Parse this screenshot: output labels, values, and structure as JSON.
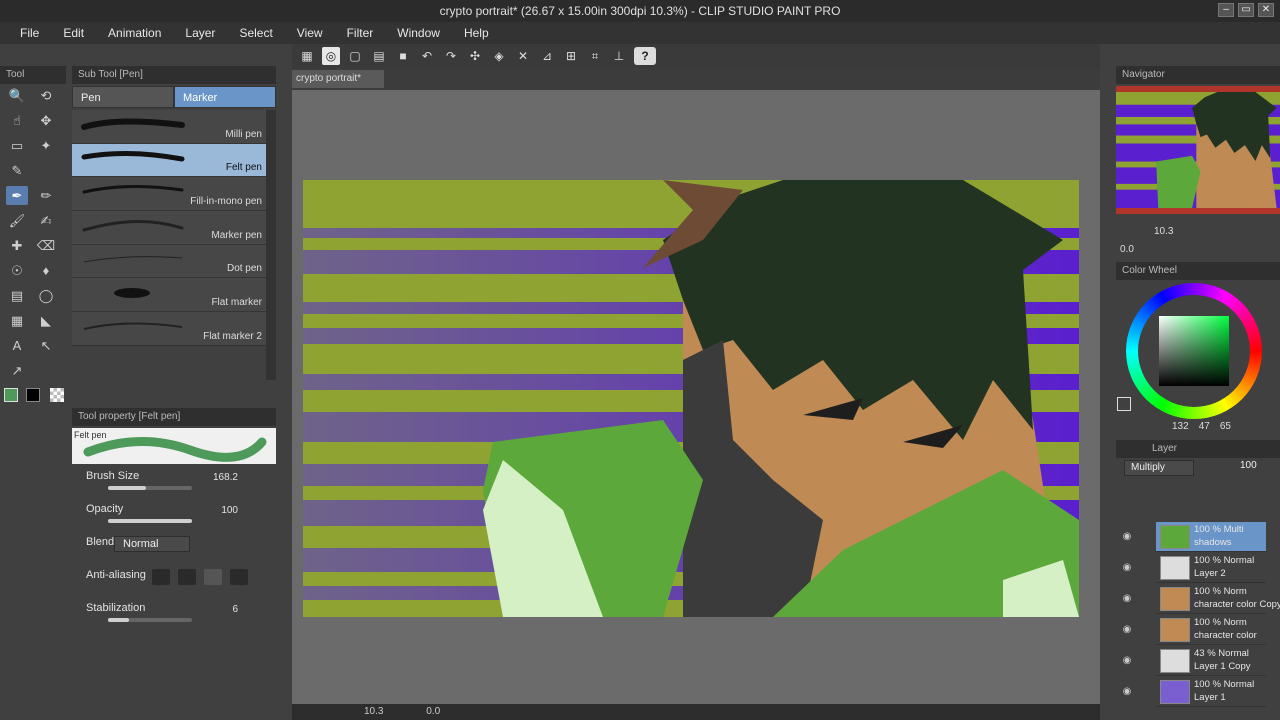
{
  "window": {
    "title": "crypto portrait* (26.67 x 15.00in 300dpi 10.3%) - CLIP STUDIO PAINT PRO"
  },
  "menu": [
    "File",
    "Edit",
    "Animation",
    "Layer",
    "Select",
    "View",
    "Filter",
    "Window",
    "Help"
  ],
  "toolbar": {
    "help_label": "?"
  },
  "panels": {
    "tool_tab": "Tool",
    "subtool_tab": "Sub Tool [Pen]",
    "tool_property_tab": "Tool property [Felt pen]",
    "navigator_tab": "Navigator",
    "color_wheel_tab": "Color Wheel",
    "layer_tab": "Layer"
  },
  "subtool": {
    "tabs": [
      {
        "label": "Pen"
      },
      {
        "label": "Marker"
      }
    ],
    "brushes": [
      {
        "label": "Milli pen"
      },
      {
        "label": "Felt pen"
      },
      {
        "label": "Fill-in-mono pen"
      },
      {
        "label": "Marker pen"
      },
      {
        "label": "Dot pen"
      },
      {
        "label": "Flat marker"
      },
      {
        "label": "Flat marker 2"
      }
    ]
  },
  "tool_property": {
    "preset_name": "Felt pen",
    "brush_size_label": "Brush Size",
    "brush_size_value": "168.2",
    "brush_size_level": 0.45,
    "opacity_label": "Opacity",
    "opacity_value": "100",
    "opacity_level": 1.0,
    "blending_label": "Blending mode",
    "blending_value": "Normal",
    "anti_aliasing_label": "Anti-aliasing",
    "stabilization_label": "Stabilization",
    "stabilization_value": "6",
    "stabilization_level": 0.25
  },
  "document": {
    "tab_label": "crypto portrait*"
  },
  "navigator": {
    "zoom": "10.3",
    "angle": "0.0"
  },
  "color": {
    "current": "#4e9a5a",
    "hsv": [
      "132",
      "47",
      "65"
    ]
  },
  "layer_panel": {
    "blend_mode": "Multiply",
    "opacity": "100",
    "layers": [
      {
        "line1": "100 % Multi",
        "line2": "shadows",
        "selected": true
      },
      {
        "line1": "100 % Normal",
        "line2": "Layer 2"
      },
      {
        "line1": "100 % Norm",
        "line2": "character color Copy"
      },
      {
        "line1": "100 % Norm",
        "line2": "character color"
      },
      {
        "line1": "43 % Normal",
        "line2": "Layer 1 Copy"
      },
      {
        "line1": "100 % Normal",
        "line2": "Layer 1"
      }
    ]
  },
  "status": {
    "zoom": "10.3",
    "angle": "0.0"
  }
}
